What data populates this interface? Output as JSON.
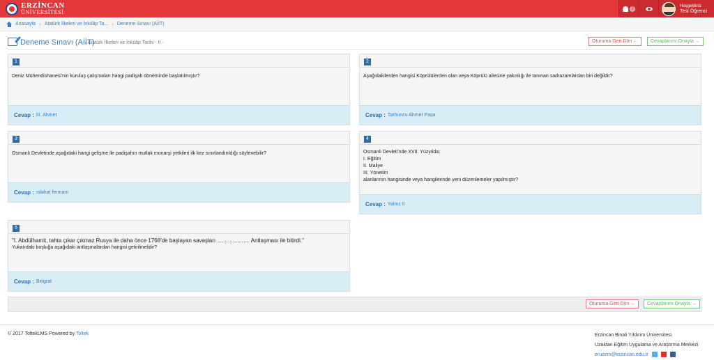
{
  "header": {
    "logo_line1": "ERZİNCAN",
    "logo_line2": "ÜNİVERSİTESİ",
    "notification_count": "3",
    "greeting": "Hoşgeldiniz",
    "user_name": "Test Öğrenci"
  },
  "breadcrumb": {
    "home": "Anasayfa",
    "course": "Atatürk İlkeleri ve İnkılâp Ta...",
    "current": "Deneme Sınavı (AİİT)"
  },
  "page": {
    "title": "Deneme Sınavı (AİİT)",
    "subtitle": "/ Atatürk İlkeleri ve İnkılâp Tarihi - II -",
    "back_button": "Oturuma Geri Dön",
    "confirm_button": "Cevaplarımı Onayla"
  },
  "answer_label": "Cevap :",
  "questions": [
    {
      "number": "1",
      "text": "Deniz Mühendishanesi'nin kuruluş çalışmaları hangi padişah döneminde başlatılmıştır?",
      "answer": "III. Ahmet"
    },
    {
      "number": "2",
      "text": "Aşağıdakilerden hangisi Köprülülerden olan veya Köprülü ailesine yakınlığı ile tanınan sadrazamlardan biri değildir?",
      "answer": "Tarhuncu Ahmet Paşa"
    },
    {
      "number": "3",
      "text": "Osmanlı Devletinde aşağıdaki hangi gelişme ile padişahın mutlak monarşi yetkileri ilk kez sınırlandırıldığı söylenebilir?",
      "answer": "ıslahat fermanı"
    },
    {
      "number": "4",
      "line1": "Osmanlı Devleti'nde XVII. Yüzyılda;",
      "line2": "I. Eğitim",
      "line3": "II. Maliye",
      "line4": "III. Yönetim",
      "line5": "alanlarının hangisinde veya hangilerinde yeni düzenlemeler yapılmıştır?",
      "answer": "Yalnız II"
    },
    {
      "number": "5",
      "line1": "\"I. Abdülhamit, tahta çıkar çıkmaz Rusya ile daha önce 1768'de başlayan savaşları ..................... Antlaşması ile bitirdi.\"",
      "line2": "Yukarıdaki boşluğa aşağıdaki antlaşmalardan hangisi getirilmelidir?",
      "answer": "Belgrat"
    }
  ],
  "footer": {
    "copyright": "© 2017 ToltekLMS Powered by",
    "powered_by": "Toltek",
    "university": "Erzincan Binali Yıldırım Üniversitesi",
    "center": "Uzaktan Eğitim Uygulama ve Araştırma Merkezi",
    "email": "eruzem@erzincan.edu.tr"
  },
  "colors": {
    "brand_red": "#e5383b",
    "primary_blue": "#2e6da4",
    "answer_bg": "#d9edf7"
  }
}
